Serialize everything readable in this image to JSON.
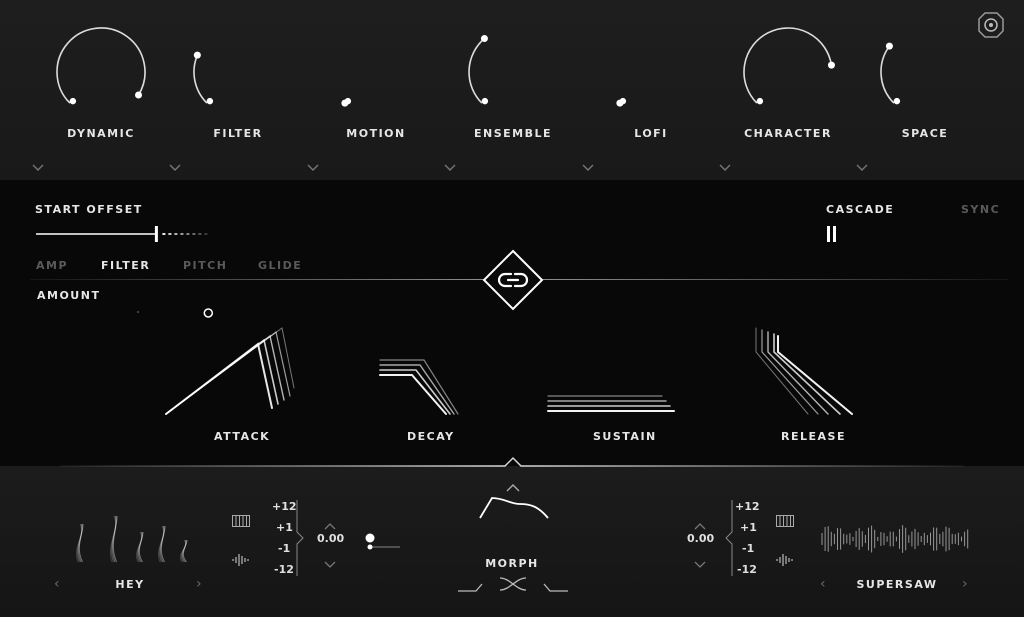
{
  "macros": [
    {
      "label": "DYNAMIC",
      "value": 0.95
    },
    {
      "label": "FILTER",
      "value": 0.25
    },
    {
      "label": "MOTION",
      "value": 0.0
    },
    {
      "label": "ENSEMBLE",
      "value": 0.35
    },
    {
      "label": "LOFI",
      "value": 0.0
    },
    {
      "label": "CHARACTER",
      "value": 0.8
    },
    {
      "label": "SPACE",
      "value": 0.3
    }
  ],
  "start_offset": {
    "label": "START OFFSET",
    "value": 0.7
  },
  "cascade": {
    "label": "CASCADE",
    "sync_label": "SYNC",
    "value": 0.0
  },
  "envelope_tabs": [
    {
      "label": "AMP",
      "active": false
    },
    {
      "label": "FILTER",
      "active": true
    },
    {
      "label": "PITCH",
      "active": false
    },
    {
      "label": "GLIDE",
      "active": false
    }
  ],
  "amount": {
    "label": "AMOUNT",
    "value": 0.85
  },
  "envelope_stages": {
    "attack": "ATTACK",
    "decay": "DECAY",
    "sustain": "SUSTAIN",
    "release": "RELEASE"
  },
  "left_source": {
    "name": "HEY",
    "transpose_values": [
      "+12",
      "+1",
      "-1",
      "-12"
    ],
    "fine": "0.00"
  },
  "right_source": {
    "name": "SUPERSAW",
    "transpose_values": [
      "+12",
      "+1",
      "-1",
      "-12"
    ],
    "fine": "0.00"
  },
  "morph": {
    "label": "MORPH",
    "value": 0.0
  },
  "colors": {
    "accent": "#ffffff",
    "dim": "#5a5a5a",
    "bg_top": "#1e1e1e",
    "bg_mid": "#080808"
  }
}
